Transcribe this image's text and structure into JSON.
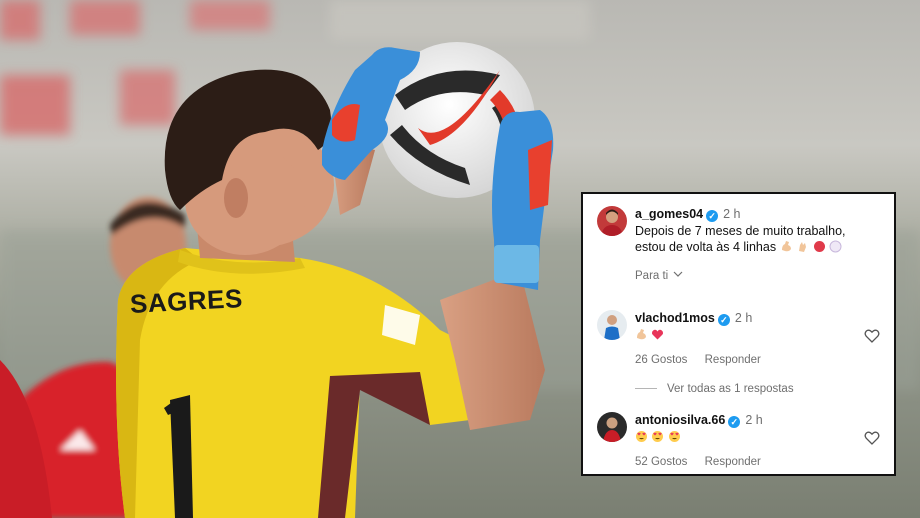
{
  "comments": [
    {
      "username": "a_gomes04",
      "verified_mark": "✓",
      "time": "2 h",
      "text": "Depois de 7 meses de muito trabalho, estou de volta às 4 linhas",
      "emojis": [
        "flexed-biceps-icon",
        "pinching-hand-icon",
        "red-circle-icon",
        "white-circle-icon"
      ],
      "translate_link": "Para ti"
    },
    {
      "username": "vlachod1mos",
      "verified_mark": "✓",
      "time": "2 h",
      "emojis": [
        "flexed-biceps-icon",
        "red-heart-icon"
      ],
      "likes": "26 Gostos",
      "reply_label": "Responder"
    },
    {
      "username": "antoniosilva.66",
      "verified_mark": "✓",
      "time": "2 h",
      "emojis": [
        "heart-eyes-icon",
        "heart-eyes-icon",
        "heart-eyes-icon"
      ],
      "likes": "52 Gostos",
      "reply_label": "Responder"
    }
  ],
  "view_replies": "Ver todas as 1 respostas",
  "photo": {
    "sponsor_text": "SAGRES",
    "shirt_number": "1"
  },
  "colors": {
    "jersey_yellow": "#f2d421",
    "verified_blue": "#1d9bf0",
    "benfica_red": "#d8212c"
  }
}
